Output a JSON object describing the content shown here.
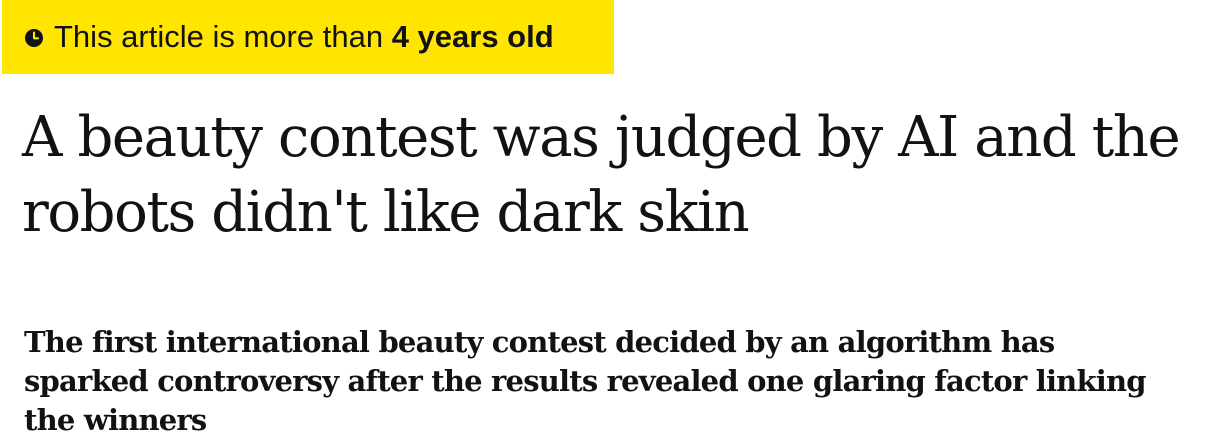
{
  "age_warning": {
    "prefix": "This article is more than",
    "age": "4 years old",
    "icon": "clock-icon",
    "background_color": "#ffe500"
  },
  "article": {
    "headline": "A beauty contest was judged by AI and the robots didn't like dark skin",
    "standfirst": "The first international beauty contest decided by an algorithm has sparked controversy after the results revealed one glaring factor linking the winners"
  }
}
